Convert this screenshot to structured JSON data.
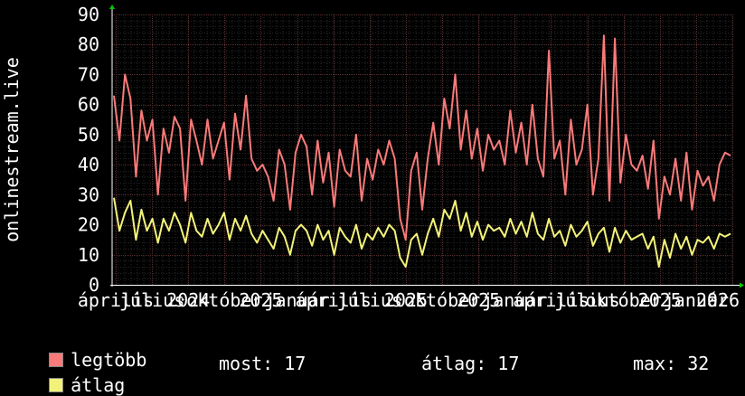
{
  "chart_data": {
    "type": "line",
    "ylabel": "onlinestream.live",
    "ylim": [
      0,
      90
    ],
    "yticks": [
      0,
      10,
      20,
      30,
      40,
      50,
      60,
      70,
      80,
      90
    ],
    "xticks": [
      "április",
      "július",
      "2024",
      "október",
      "2025",
      "január",
      "április",
      "július",
      "2025",
      "október",
      "2025",
      "január",
      "április",
      "július",
      "október",
      "2025",
      "január",
      "2026"
    ],
    "grid": true,
    "x": [
      "2024-03-30",
      "2024-04-06",
      "2024-04-13",
      "2024-04-20",
      "2024-04-27",
      "2024-05-04",
      "2024-05-11",
      "2024-05-18",
      "2024-05-25",
      "2024-06-01",
      "2024-06-08",
      "2024-06-15",
      "2024-06-22",
      "2024-06-29",
      "2024-07-06",
      "2024-07-13",
      "2024-07-20",
      "2024-07-27",
      "2024-08-03",
      "2024-08-10",
      "2024-08-17",
      "2024-08-24",
      "2024-08-31",
      "2024-09-07",
      "2024-09-14",
      "2024-09-21",
      "2024-09-28",
      "2024-10-05",
      "2024-10-12",
      "2024-10-19",
      "2024-10-26",
      "2024-11-02",
      "2024-11-09",
      "2024-11-16",
      "2024-11-23",
      "2024-11-30",
      "2024-12-07",
      "2024-12-14",
      "2024-12-21",
      "2024-12-28",
      "2025-01-04",
      "2025-01-11",
      "2025-01-18",
      "2025-01-25",
      "2025-02-01",
      "2025-02-08",
      "2025-02-15",
      "2025-02-22",
      "2025-03-01",
      "2025-03-08",
      "2025-03-15",
      "2025-03-22",
      "2025-03-29",
      "2025-04-05",
      "2025-04-12",
      "2025-04-19",
      "2025-04-26",
      "2025-05-03",
      "2025-05-10",
      "2025-05-17",
      "2025-05-24",
      "2025-05-31",
      "2025-06-07",
      "2025-06-14",
      "2025-06-21",
      "2025-06-28",
      "2025-07-05",
      "2025-07-12",
      "2025-07-19",
      "2025-07-26",
      "2025-08-02",
      "2025-08-09",
      "2025-08-16",
      "2025-08-23",
      "2025-08-30",
      "2025-09-06",
      "2025-09-13",
      "2025-09-20",
      "2025-09-27",
      "2025-10-04",
      "2025-10-11",
      "2025-10-18",
      "2025-10-25",
      "2025-11-01",
      "2025-11-08",
      "2025-11-15",
      "2025-11-22",
      "2025-11-29",
      "2025-12-06",
      "2025-12-13",
      "2025-12-20",
      "2025-12-27",
      "2026-01-03",
      "2026-01-10",
      "2026-01-17",
      "2026-01-24",
      "2026-01-31",
      "2026-02-07"
    ],
    "series": [
      {
        "name": "legtöbb",
        "color": "#f87a7a",
        "values": [
          63,
          48,
          70,
          62,
          36,
          58,
          48,
          55,
          30,
          52,
          44,
          56,
          52,
          28,
          55,
          48,
          40,
          55,
          42,
          48,
          54,
          35,
          57,
          45,
          63,
          42,
          38,
          40,
          36,
          28,
          45,
          40,
          25,
          44,
          50,
          46,
          30,
          48,
          34,
          44,
          26,
          45,
          38,
          36,
          50,
          28,
          42,
          35,
          45,
          40,
          48,
          42,
          22,
          15,
          38,
          44,
          25,
          42,
          54,
          40,
          62,
          52,
          70,
          45,
          58,
          42,
          52,
          38,
          50,
          45,
          48,
          40,
          58,
          44,
          54,
          40,
          60,
          42,
          36,
          78,
          42,
          48,
          30,
          55,
          40,
          45,
          60,
          30,
          42,
          83,
          28,
          82,
          34,
          50,
          40,
          38,
          43,
          32,
          48,
          22,
          36,
          30,
          42,
          28,
          44,
          25,
          38,
          33,
          36,
          28,
          40,
          44,
          43
        ]
      },
      {
        "name": "átlag",
        "color": "#f2f27a",
        "values": [
          29,
          18,
          24,
          28,
          15,
          25,
          18,
          22,
          14,
          22,
          18,
          24,
          20,
          14,
          24,
          18,
          16,
          22,
          17,
          20,
          24,
          15,
          22,
          18,
          23,
          17,
          14,
          18,
          15,
          12,
          19,
          16,
          10,
          18,
          20,
          18,
          13,
          20,
          15,
          18,
          10,
          19,
          16,
          14,
          20,
          12,
          17,
          15,
          19,
          16,
          20,
          18,
          9,
          6,
          15,
          17,
          10,
          17,
          22,
          16,
          25,
          22,
          28,
          18,
          24,
          16,
          21,
          15,
          20,
          18,
          19,
          16,
          22,
          17,
          21,
          16,
          24,
          17,
          15,
          22,
          16,
          18,
          13,
          20,
          16,
          18,
          21,
          13,
          17,
          19,
          11,
          19,
          14,
          18,
          15,
          16,
          17,
          12,
          16,
          6,
          15,
          9,
          17,
          12,
          16,
          10,
          15,
          14,
          16,
          12,
          17,
          16,
          17
        ]
      }
    ]
  },
  "legend": [
    {
      "name": "legtöbb",
      "color": "#f87a7a"
    },
    {
      "name": "átlag",
      "color": "#f2f27a"
    }
  ],
  "stats": {
    "most": "most: 17",
    "atlag": "átlag: 17",
    "max": "max: 32"
  }
}
